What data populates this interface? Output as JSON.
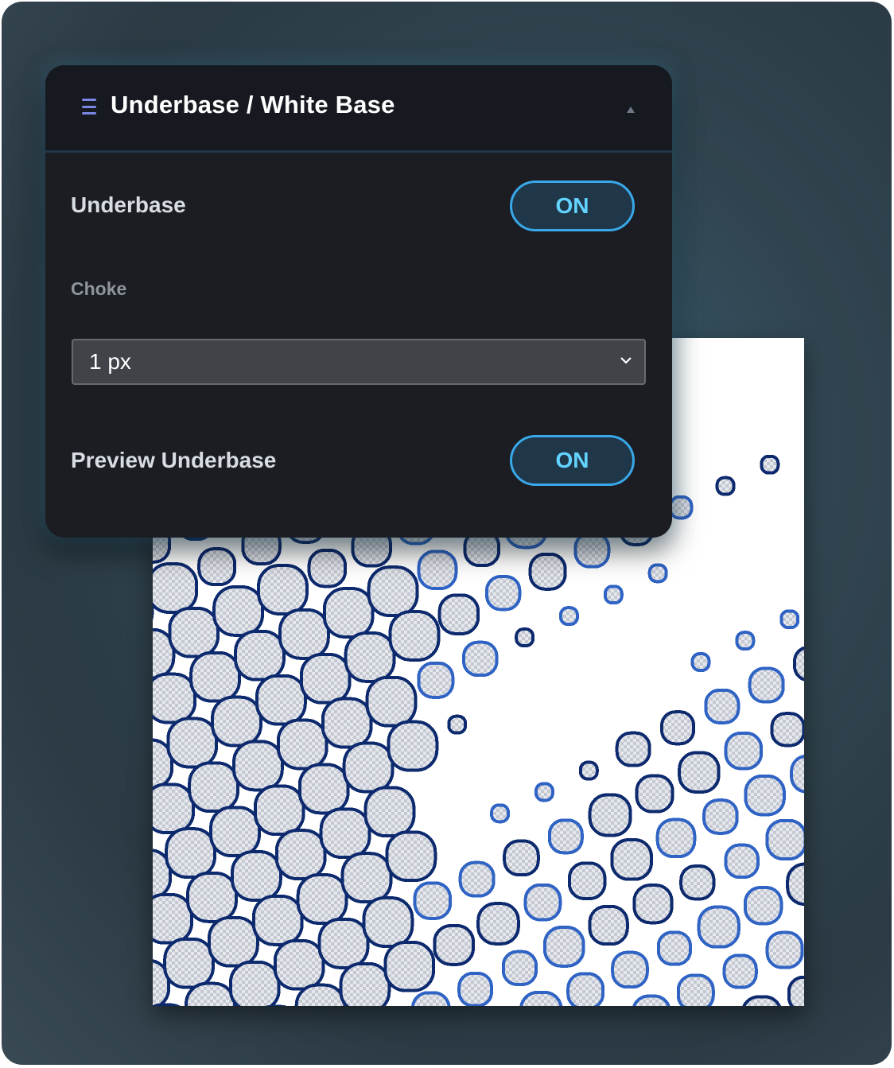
{
  "panel": {
    "title": "Underbase / White Base",
    "icon": "menu-icon",
    "collapse_icon": "triangle-up-icon"
  },
  "underbase": {
    "label": "Underbase",
    "toggle": "ON"
  },
  "choke": {
    "label": "Choke",
    "value": "1 px"
  },
  "preview_underbase": {
    "label": "Preview Underbase",
    "toggle": "ON"
  },
  "colors": {
    "accent": "#38a8e8",
    "toggle_text": "#63d4ff",
    "panel_bg": "#1b1d22",
    "dot_outline_dark": "#0d2a6e",
    "dot_outline_light": "#2f63c4"
  }
}
